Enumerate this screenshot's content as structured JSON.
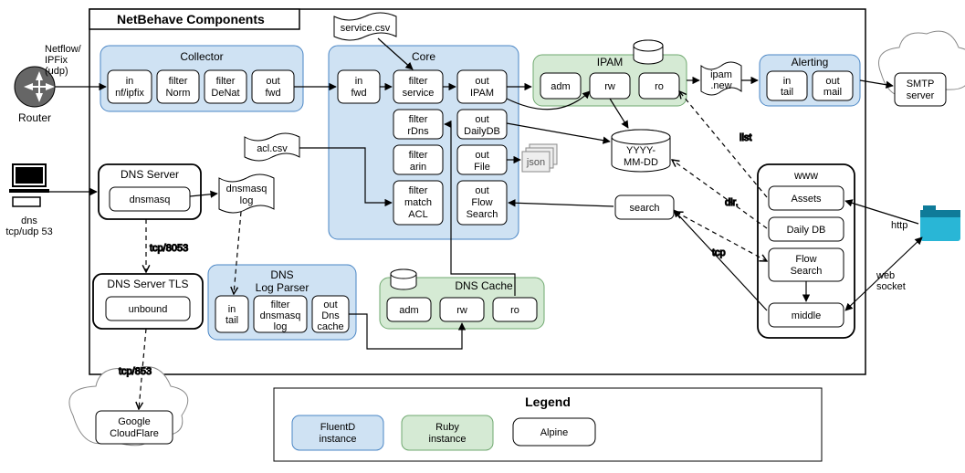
{
  "title": "NetBehave Components",
  "external": {
    "router": "Router",
    "netflow_label_l1": "Netflow/",
    "netflow_label_l2": "IPFix",
    "netflow_label_l3": "(udp)",
    "pc_dns_l1": "dns",
    "pc_dns_l2": "tcp/udp 53",
    "smtp_l1": "SMTP",
    "smtp_l2": "server",
    "google_l1": "Google",
    "google_l2": "CloudFlare",
    "http": "http",
    "websocket_l1": "web",
    "websocket_l2": "socket"
  },
  "groups": {
    "collector": "Collector",
    "core": "Core",
    "ipam": "IPAM",
    "alerting": "Alerting",
    "dns_server": "DNS Server",
    "dns_server_tls": "DNS Server TLS",
    "dns_log_parser_l1": "DNS",
    "dns_log_parser_l2": "Log Parser",
    "dns_cache": "DNS Cache",
    "www": "www"
  },
  "nodes": {
    "in_nfipfix_l1": "in",
    "in_nfipfix_l2": "nf/ipfix",
    "filter_norm_l1": "filter",
    "filter_norm_l2": "Norm",
    "filter_denat_l1": "filter",
    "filter_denat_l2": "DeNat",
    "out_fwd_l1": "out",
    "out_fwd_l2": "fwd",
    "in_fwd_l1": "in",
    "in_fwd_l2": "fwd",
    "filter_service_l1": "filter",
    "filter_service_l2": "service",
    "filter_rdns_l1": "filter",
    "filter_rdns_l2": "rDns",
    "filter_arin_l1": "filter",
    "filter_arin_l2": "arin",
    "filter_match_acl_l1": "filter",
    "filter_match_acl_l2": "match",
    "filter_match_acl_l3": "ACL",
    "out_ipam_l1": "out",
    "out_ipam_l2": "IPAM",
    "out_dailydb_l1": "out",
    "out_dailydb_l2": "DailyDB",
    "out_file_l1": "out",
    "out_file_l2": "File",
    "out_flowsearch_l1": "out",
    "out_flowsearch_l2": "Flow",
    "out_flowsearch_l3": "Search",
    "dnsmasq": "dnsmasq",
    "unbound": "unbound",
    "dnsmasqlog_l1": "dnsmasq",
    "dnsmasqlog_l2": "log",
    "acl_csv": "acl.csv",
    "service_csv": "service.csv",
    "in_tail_l1": "in",
    "in_tail_l2": "tail",
    "filter_dnsmasqlog_l1": "filter",
    "filter_dnsmasqlog_l2": "dnsmasq",
    "filter_dnsmasqlog_l3": "log",
    "out_dnscache_l1": "out",
    "out_dnscache_l2": "Dns",
    "out_dnscache_l3": "cache",
    "adm": "adm",
    "rw": "rw",
    "ro": "ro",
    "json": "json",
    "yyyy_l1": "YYYY-",
    "yyyy_l2": "MM-DD",
    "ipamnew_l1": "ipam",
    "ipamnew_l2": ".new",
    "assets": "Assets",
    "dailydb": "Daily DB",
    "flowsearch_l1": "Flow",
    "flowsearch_l2": "Search",
    "middle": "middle",
    "search": "search",
    "tcp8053": "tcp/8053",
    "tcp853": "tcp/853",
    "list": "list",
    "dir": "dir.",
    "tcp": "tcp",
    "alert_in_tail_l1": "in",
    "alert_in_tail_l2": "tail",
    "alert_out_mail_l1": "out",
    "alert_out_mail_l2": "mail"
  },
  "legend": {
    "title": "Legend",
    "fluentd_l1": "FluentD",
    "fluentd_l2": "instance",
    "ruby_l1": "Ruby",
    "ruby_l2": "instance",
    "alpine": "Alpine"
  }
}
